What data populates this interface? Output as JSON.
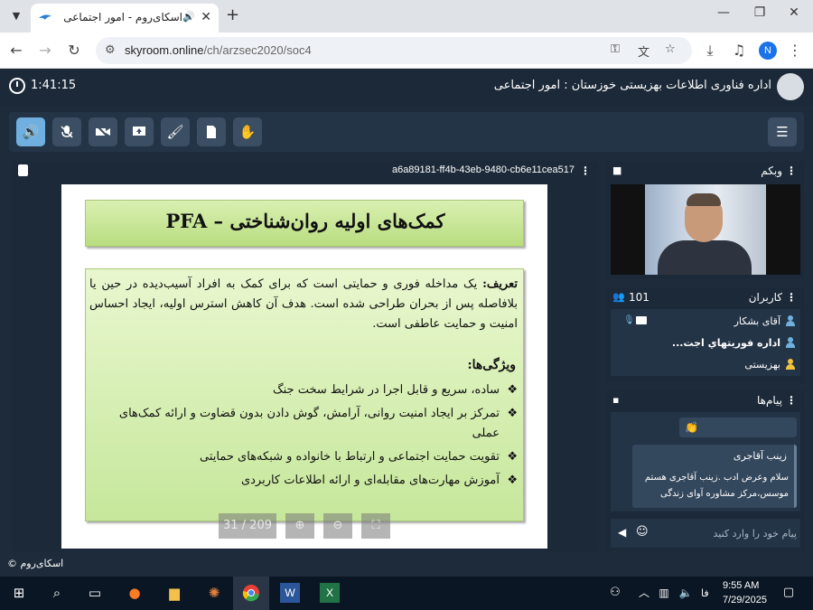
{
  "browser": {
    "tab_title": "اسکای‌روم - امور اجتماعی",
    "url_host": "skyroom.online",
    "url_path": "/ch/arzsec2020/soc4",
    "profile_initial": "N"
  },
  "app": {
    "timer": "1:41:15",
    "room_title": "اداره فناوری اطلاعات بهزیستی خوزستان : امور اجتماعی",
    "brand": "اسکای‌روم ©"
  },
  "toolbar": {
    "buttons": [
      "speaker-icon",
      "mic-off-icon",
      "camera-off-icon",
      "screen-share-icon",
      "brush-icon",
      "file-icon",
      "raise-hand-icon"
    ],
    "menu": "menu-icon"
  },
  "presentation": {
    "file_id": "a6a89181-ff4b-43eb-9480-cb6e11cea517",
    "slide_title": "کمک‌های اولیه روان‌شناختی – PFA",
    "definition_label": "تعریف:",
    "definition_text": " یک مداخله فوری و حمایتی است که برای کمک به افراد آسیب‌دیده در حین یا بلافاصله پس از بحران طراحی شده است. هدف آن کاهش استرس اولیه، ایجاد احساس امنیت و حمایت عاطفی است.",
    "features_heading": "ویژگی‌ها:",
    "bullets": [
      "ساده، سریع و قابل اجرا در شرایط سخت جنگ",
      "تمرکز بر ایجاد امنیت روانی، آرامش، گوش دادن بدون قضاوت و ارائه کمک‌های عملی",
      "تقویت حمایت اجتماعی و ارتباط با خانواده و شبکه‌های حمایتی",
      "آموزش مهارت‌های مقابله‌ای و ارائه اطلاعات کاربردی"
    ],
    "page_indicator": "31 / 209"
  },
  "webcam": {
    "title": "وبکم"
  },
  "users": {
    "title": "کاربران",
    "count": "101",
    "list": [
      {
        "name": "آقای بشکار",
        "color": "#6fb0e0"
      },
      {
        "name": "اداره فوریتهاي اجت...",
        "color": "#6fb0e0"
      },
      {
        "name": "بهزیستی",
        "color": "#f5c33b"
      }
    ]
  },
  "chat": {
    "title": "پیام‌ها",
    "emoji_message": "👏",
    "message_author": "زینب آقاجری",
    "message_text": "سلام وعرض ادب .زینب آقاجری هستم موسس،مرکز مشاوره آوای زندگی",
    "input_placeholder": "پیام خود را وارد کنید"
  },
  "taskbar": {
    "time": "9:55 AM",
    "date": "7/29/2025",
    "lang": "فا"
  }
}
